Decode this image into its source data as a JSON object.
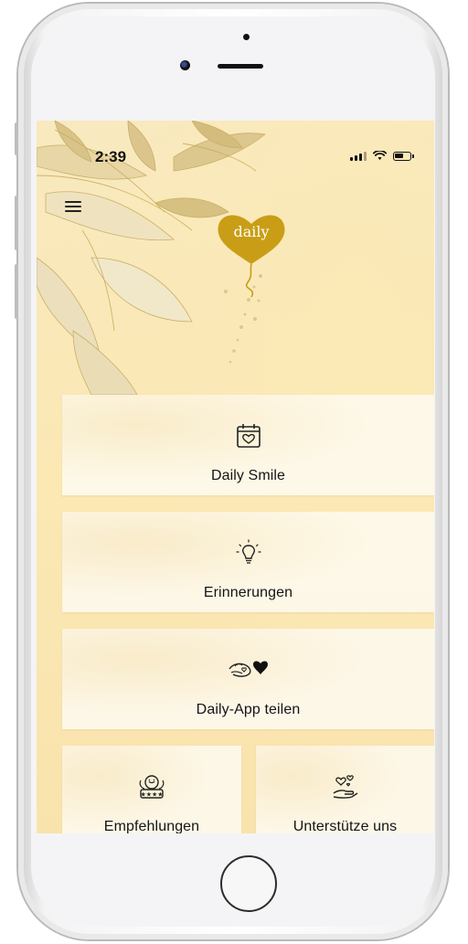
{
  "status_bar": {
    "time": "2:39"
  },
  "header": {
    "logo_text": "daily"
  },
  "menu": [
    {
      "label": "Daily Smile",
      "icon": "calendar-heart-icon"
    },
    {
      "label": "Erinnerungen",
      "icon": "lightbulb-icon"
    },
    {
      "label": "Daily-App teilen",
      "icon": "heart-hands-icon"
    },
    {
      "label": "Empfehlungen",
      "icon": "stars-badge-icon"
    },
    {
      "label": "Unterstütze uns",
      "icon": "hand-hearts-icon"
    }
  ],
  "colors": {
    "accent": "#c99e16",
    "background": "#f9e8b9",
    "card": "#fdf8ec"
  }
}
